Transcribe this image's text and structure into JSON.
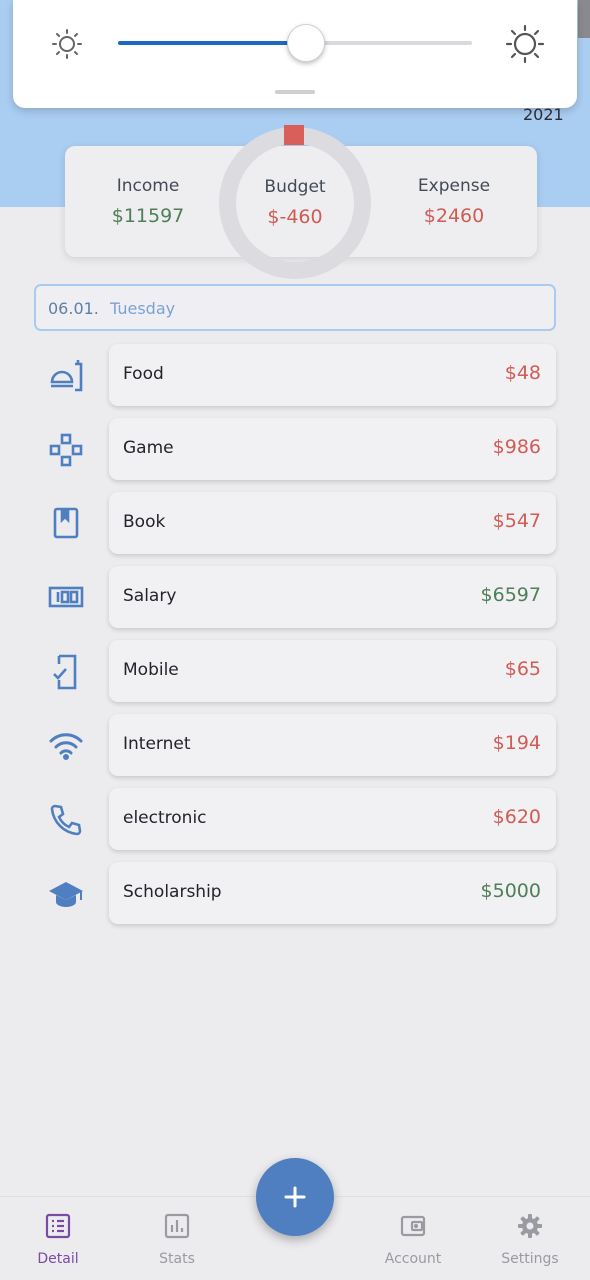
{
  "brightness": {
    "level_percent": 53
  },
  "year": "2021",
  "summary": {
    "income_label": "Income",
    "income_value": "$11597",
    "budget_label": "Budget",
    "budget_value": "$-460",
    "expense_label": "Expense",
    "expense_value": "$2460"
  },
  "date_header": {
    "day": "06.01.",
    "weekday": "Tuesday"
  },
  "transactions": [
    {
      "name": "Food",
      "amount": "$48",
      "type": "expense",
      "icon": "food-icon"
    },
    {
      "name": "Game",
      "amount": "$986",
      "type": "expense",
      "icon": "gamepad-icon"
    },
    {
      "name": "Book",
      "amount": "$547",
      "type": "expense",
      "icon": "book-icon"
    },
    {
      "name": "Salary",
      "amount": "$6597",
      "type": "income",
      "icon": "money-icon"
    },
    {
      "name": "Mobile",
      "amount": "$65",
      "type": "expense",
      "icon": "mobile-icon"
    },
    {
      "name": "Internet",
      "amount": "$194",
      "type": "expense",
      "icon": "wifi-icon"
    },
    {
      "name": "electronic",
      "amount": "$620",
      "type": "expense",
      "icon": "phone-icon"
    },
    {
      "name": "Scholarship",
      "amount": "$5000",
      "type": "income",
      "icon": "graduation-cap-icon"
    }
  ],
  "nav": {
    "detail": "Detail",
    "stats": "Stats",
    "account": "Account",
    "settings": "Settings"
  },
  "colors": {
    "income": "#4d7f58",
    "expense": "#d15c55",
    "accent": "#4f7fc0",
    "active_nav": "#7b4aa3"
  }
}
